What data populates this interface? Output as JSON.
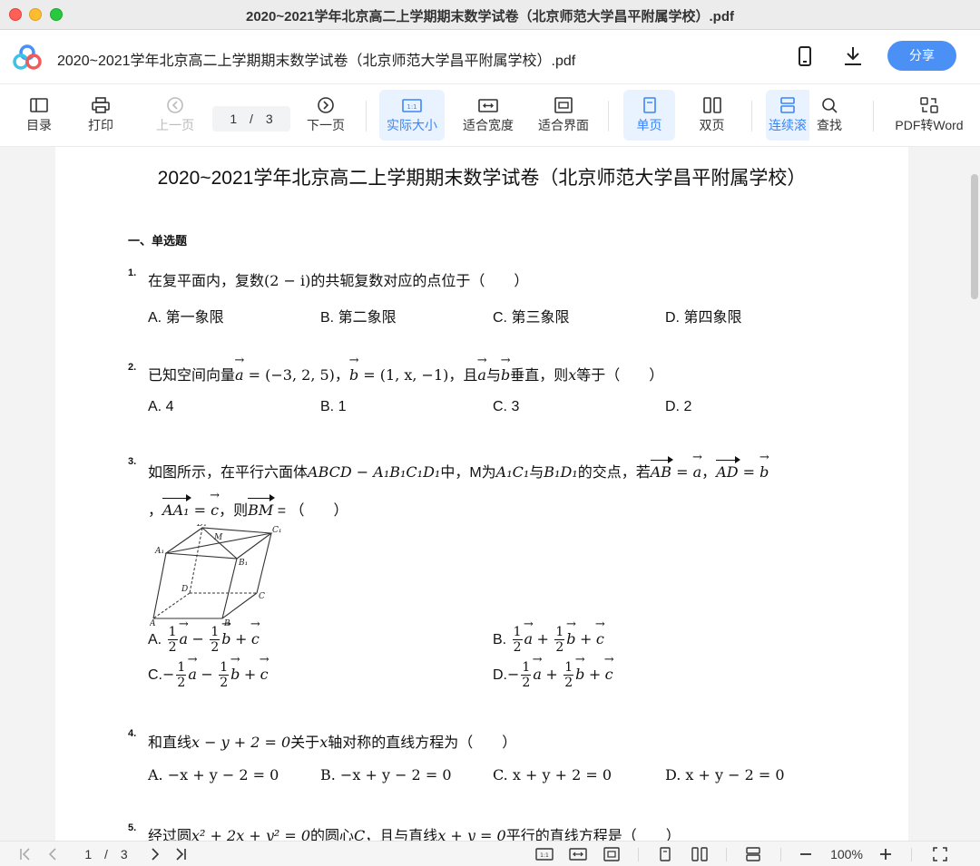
{
  "window": {
    "title": "2020~2021学年北京高二上学期期末数学试卷（北京师范大学昌平附属学校）.pdf"
  },
  "header": {
    "doc_title": "2020~2021学年北京高二上学期期末数学试卷（北京师范大学昌平附属学校）.pdf",
    "share_label": "分享"
  },
  "toolbar": {
    "toc": "目录",
    "print": "打印",
    "prev": "上一页",
    "page_current": "1",
    "page_sep": "/",
    "page_total": "3",
    "next": "下一页",
    "actual_size": "实际大小",
    "fit_width": "适合宽度",
    "fit_screen": "适合界面",
    "single": "单页",
    "double": "双页",
    "continuous": "连续滚",
    "find": "查找",
    "pdf_to_word": "PDF转Word"
  },
  "paper": {
    "title": "2020~2021学年北京高二上学期期末数学试卷（北京师范大学昌平附属学校）",
    "section": "一、单选题",
    "q1": {
      "num": "1.",
      "t1": "在复平面内，复数",
      "expr": "(2 − i)",
      "t2": "的共轭复数对应的点位于（　　）",
      "A": "A. 第一象限",
      "B": "B. 第二象限",
      "C": "C. 第三象限",
      "D": "D. 第四象限"
    },
    "q2": {
      "num": "2.",
      "t1": "已知空间向量",
      "a": "a",
      "e1": " = (−3, 2, 5)",
      "t2": "，",
      "b": "b",
      "e2": " = (1, x, −1)",
      "t3": "，且",
      "t4": "与",
      "t5": "垂直，则",
      "x": "x",
      "t6": "等于（　　）",
      "A": "A. 4",
      "B": "B. 1",
      "C": "C. 3",
      "D": "D. 2"
    },
    "q3": {
      "num": "3.",
      "t1": "如图所示，在平行六面体",
      "solid": "ABCD − A₁B₁C₁D₁",
      "t2": "中，M为",
      "d1": "A₁C₁",
      "t3": "与",
      "d2": "B₁D₁",
      "t4": "的交点，若",
      "AB": "AB",
      "eq": " = ",
      "a": "a",
      "comma": "，",
      "AD": "AD",
      "b": "b",
      "line2_lead": "，",
      "AA1": "AA₁",
      "c": "c",
      "t5": "，则",
      "BM": "BM",
      "t6": " = （　　）",
      "optA": "A.",
      "optB": "B.",
      "optC": "C.",
      "optD": "D.",
      "half_num": "1",
      "half_den": "2",
      "minus": "−",
      "plus": "+",
      "fig": {
        "D1": "D₁",
        "C1": "C₁",
        "A1": "A₁",
        "M": "M",
        "B1": "B₁",
        "D": "D",
        "C": "C",
        "A": "A",
        "B": "B"
      }
    },
    "q4": {
      "num": "4.",
      "t1": "和直线",
      "line": "x − y + 2 = 0",
      "t2": "关于",
      "x": "x",
      "t3": "轴对称的直线方程为（　　）",
      "A": "A. −x + y − 2 = 0",
      "B": "B. −x + y − 2 = 0",
      "C": "C. x + y + 2 = 0",
      "D": "D. x + y − 2 = 0"
    },
    "q5": {
      "num": "5.",
      "t1": "经过圆",
      "circle": "x² + 2x + y² = 0",
      "t2": "的圆心",
      "C": "C",
      "t3": "，且与直线",
      "line": "x + y = 0",
      "t4": "平行的直线方程是（　　）"
    }
  },
  "bottombar": {
    "page_current": "1",
    "page_sep": "/",
    "page_total": "3",
    "zoom": "100%"
  }
}
